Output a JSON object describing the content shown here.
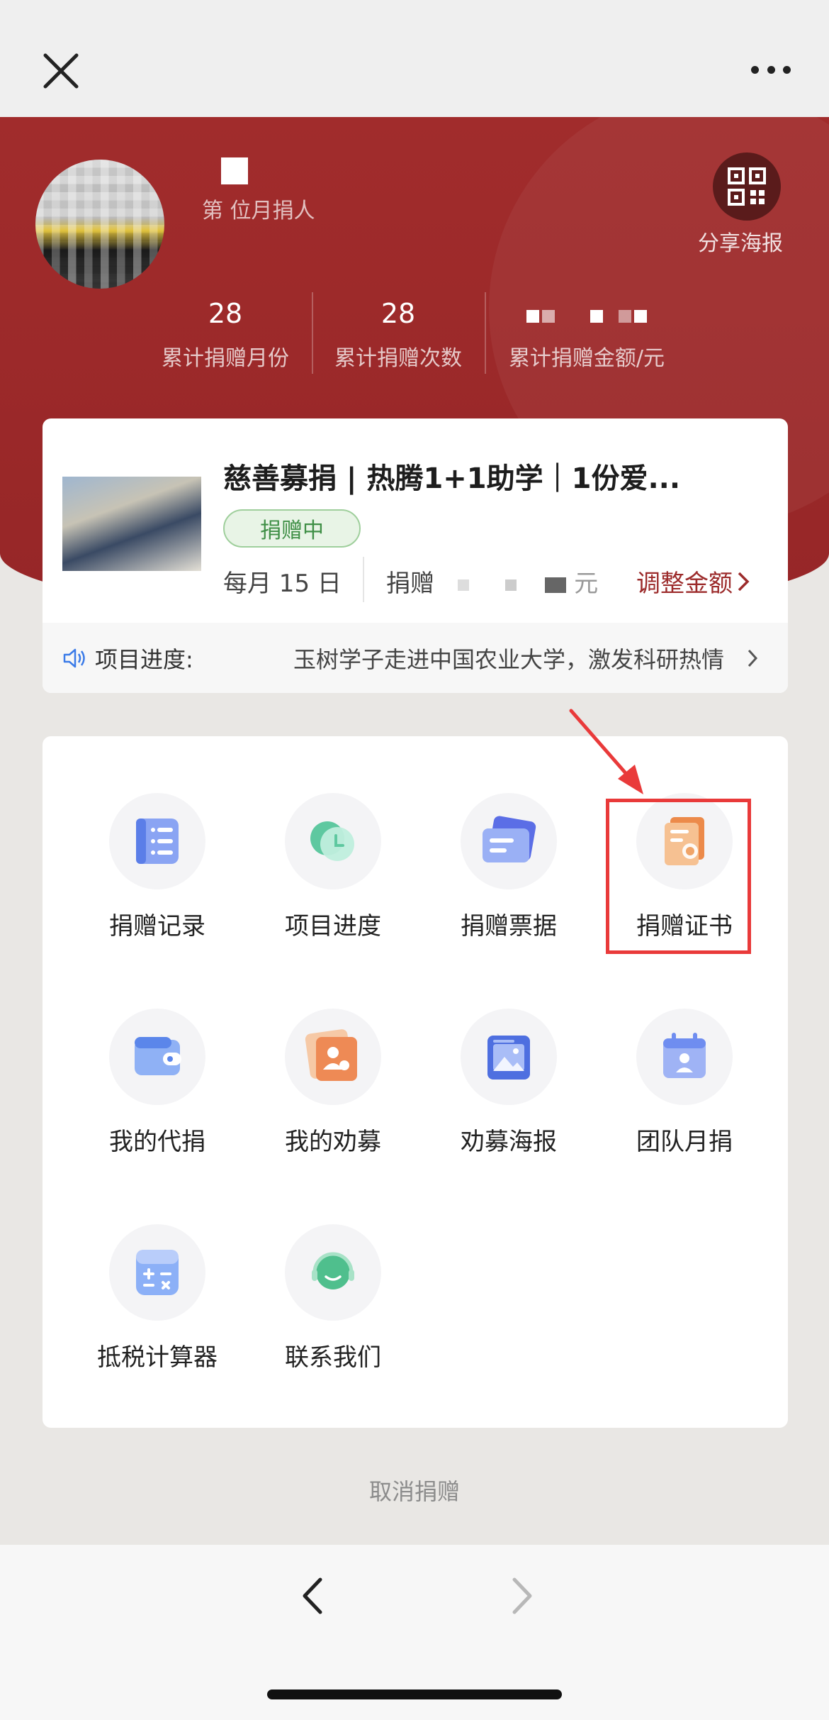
{
  "header": {
    "close_icon": "close-icon",
    "more_icon": "more-icon"
  },
  "profile": {
    "subtitle": "第      位月捐人",
    "share_label": "分享海报",
    "stats": [
      {
        "value": "28",
        "label": "累计捐赠月份"
      },
      {
        "value": "28",
        "label": "累计捐赠次数"
      },
      {
        "value": "",
        "label": "累计捐赠金额/元"
      }
    ]
  },
  "project": {
    "title": "慈善募捐 | 热腾1+1助学｜1份爱...",
    "status": "捐赠中",
    "monthly": "每月 15 日",
    "donate_prefix": "捐赠",
    "donate_suffix": "元",
    "adjust_label": "调整金额",
    "progress_label": "项目进度:",
    "progress_text": "玉树学子走进中国农业大学，激发科研热情"
  },
  "menu": [
    {
      "label": "捐赠记录",
      "icon": "list-icon"
    },
    {
      "label": "项目进度",
      "icon": "clock-icon"
    },
    {
      "label": "捐赠票据",
      "icon": "receipt-icon"
    },
    {
      "label": "捐赠证书",
      "icon": "certificate-icon"
    },
    {
      "label": "我的代捐",
      "icon": "wallet-icon"
    },
    {
      "label": "我的劝募",
      "icon": "user-card-icon"
    },
    {
      "label": "劝募海报",
      "icon": "poster-icon"
    },
    {
      "label": "团队月捐",
      "icon": "team-calendar-icon"
    },
    {
      "label": "抵税计算器",
      "icon": "calculator-icon"
    },
    {
      "label": "联系我们",
      "icon": "headset-icon"
    }
  ],
  "footer": {
    "cancel_label": "取消捐赠"
  },
  "colors": {
    "brand_red": "#9b2a2a",
    "highlight": "#e93a3a",
    "status_green": "#3f8f46"
  }
}
